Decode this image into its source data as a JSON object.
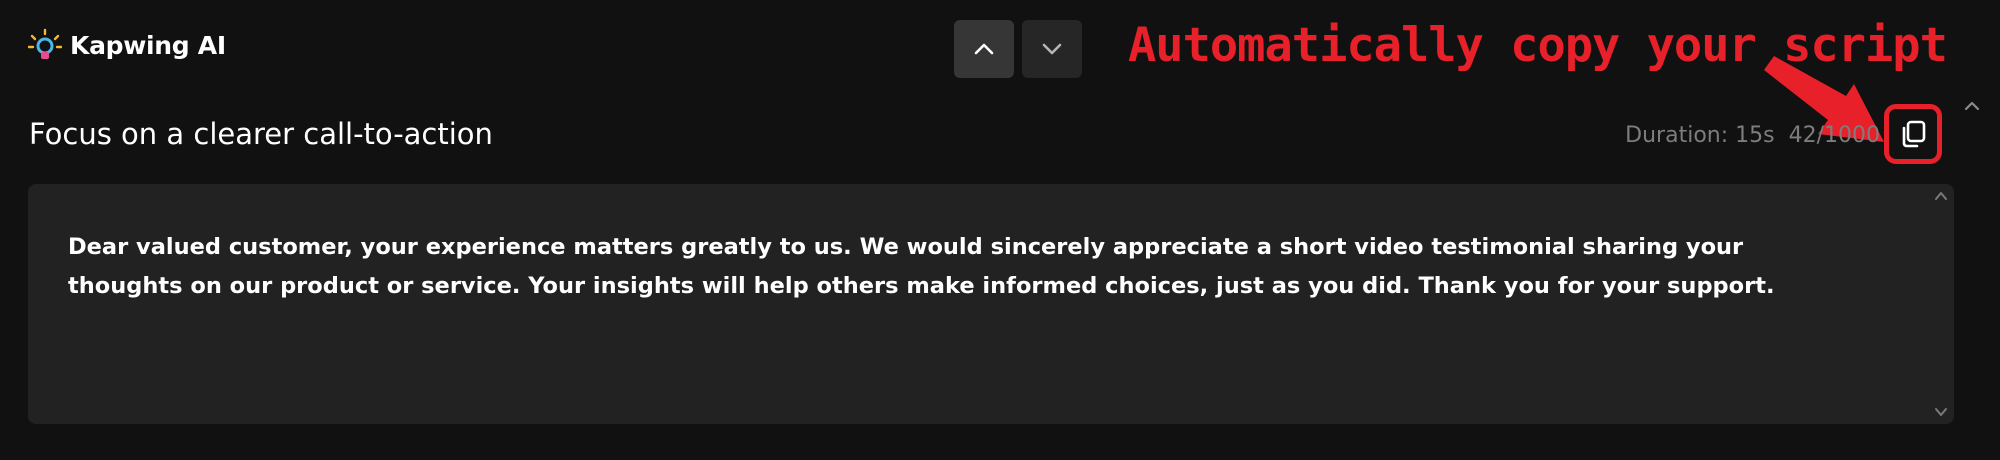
{
  "app": {
    "name": "Kapwing AI",
    "logo_icon": "lightbulb-sparkle-icon"
  },
  "nav": {
    "up_icon": "chevron-up-icon",
    "down_icon": "chevron-down-icon"
  },
  "annotation": {
    "text": "Automatically copy your script",
    "color": "#e8202a",
    "arrow_icon": "red-arrow-icon"
  },
  "script": {
    "title": "Focus on a clearer call-to-action",
    "duration": "Duration: 15s",
    "char_count": "42/1000",
    "copy_icon": "copy-icon",
    "body": "Dear valued customer, your experience matters greatly to us. We would sincerely appreciate a short video testimonial sharing your thoughts on our product or service. Your insights will help others make informed choices, just as you did. Thank you for your support."
  },
  "colors": {
    "background": "#111111",
    "panel": "#222222",
    "muted_text": "#7d7d7d",
    "highlight": "#e8202a"
  }
}
